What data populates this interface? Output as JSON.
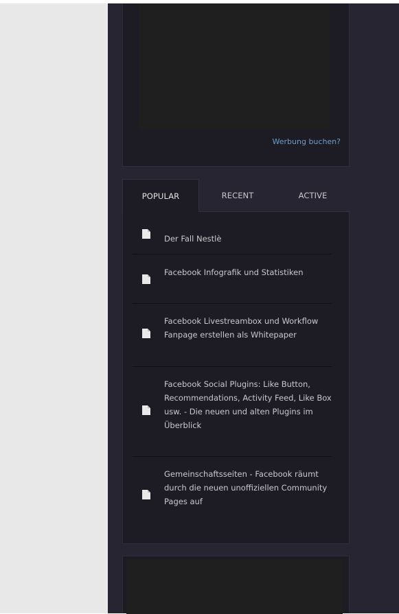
{
  "ad_widget": {
    "link_text": "Werbung buchen?"
  },
  "tabs": [
    {
      "label": "POPULAR",
      "active": true
    },
    {
      "label": "RECENT",
      "active": false
    },
    {
      "label": "ACTIVE",
      "active": false
    }
  ],
  "popular_posts": [
    {
      "title": "Der Fall Nestlè",
      "icon": "document-icon"
    },
    {
      "title": "Facebook Infografik und Statistiken",
      "icon": "document-icon"
    },
    {
      "title": "Facebook Livestreambox und Workflow Fanpage erstellen als Whitepaper",
      "icon": "document-icon"
    },
    {
      "title": "Facebook Social Plugins: Like Button, Recommendations, Activity Feed, Like Box usw. - Die neuen und alten Plugins im Überblick",
      "icon": "document-icon"
    },
    {
      "title": "Gemeinschaftsseiten - Facebook räumt durch die neuen unoffiziellen Community Pages auf",
      "icon": "document-icon"
    }
  ],
  "colors": {
    "page_left_background": "#e8e8e8",
    "sidebar_background": "#262531",
    "widget_background": "#1d1c24",
    "link": "#6f9cc9",
    "text": "#c9c9cd"
  }
}
